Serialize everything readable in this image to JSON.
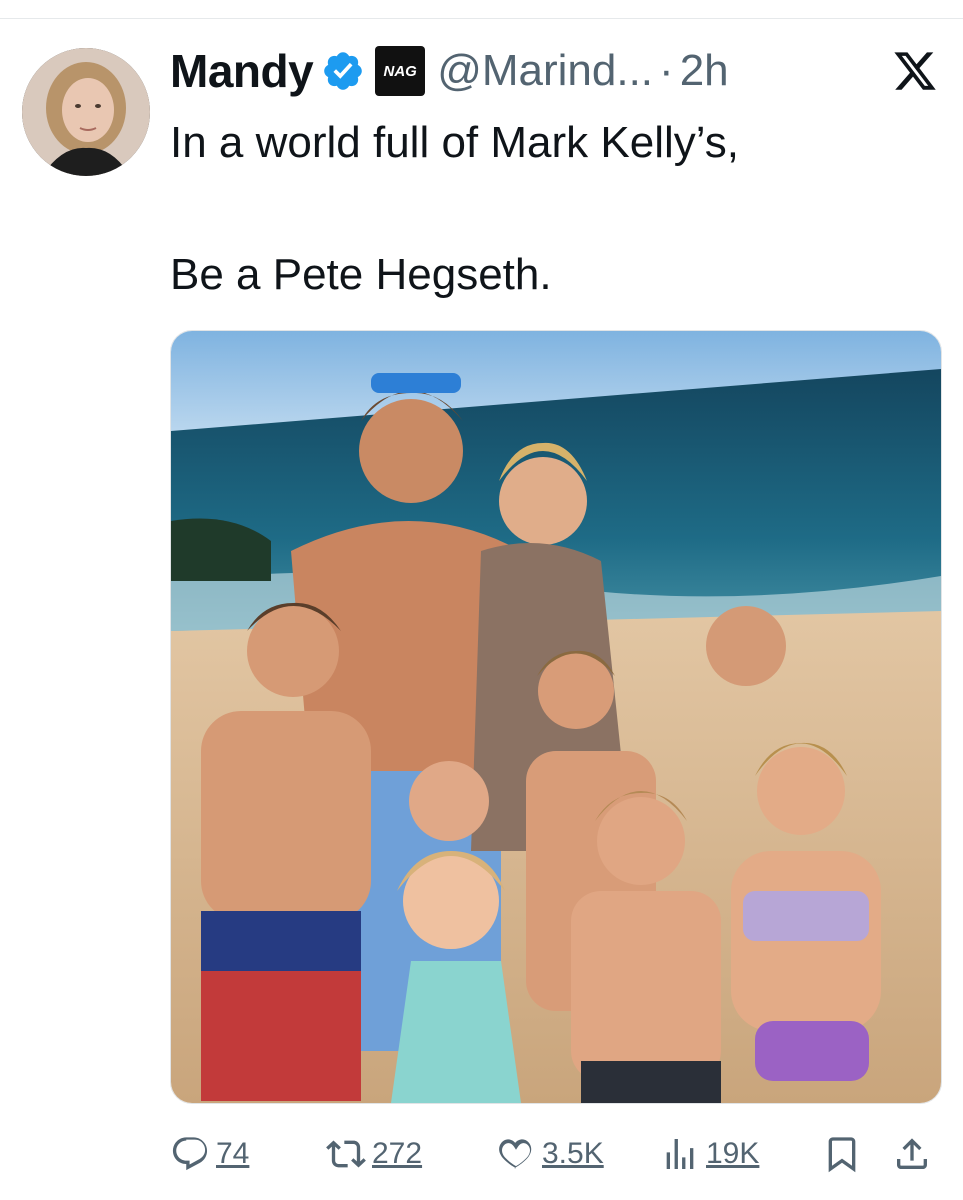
{
  "post": {
    "author": {
      "display_name": "Mandy",
      "handle": "@Marind...",
      "affiliate_badge": "NAG",
      "verified": true
    },
    "separator": "·",
    "time": "2h",
    "text_lines": [
      "In a world full of Mark Kelly’s,",
      "Be a Pete Hegseth."
    ],
    "media_type": "photo",
    "actions": {
      "replies": "74",
      "reposts": "272",
      "likes": "3.5K",
      "views": "19K"
    }
  },
  "icons": {
    "verified": "verified-badge-icon",
    "platform": "x-logo-icon",
    "reply": "reply-icon",
    "repost": "repost-icon",
    "like": "heart-icon",
    "views": "views-icon",
    "bookmark": "bookmark-icon",
    "share": "share-icon"
  },
  "colors": {
    "verified_blue": "#1d9bf0",
    "secondary_text": "#536471",
    "primary_text": "#0f1419"
  }
}
